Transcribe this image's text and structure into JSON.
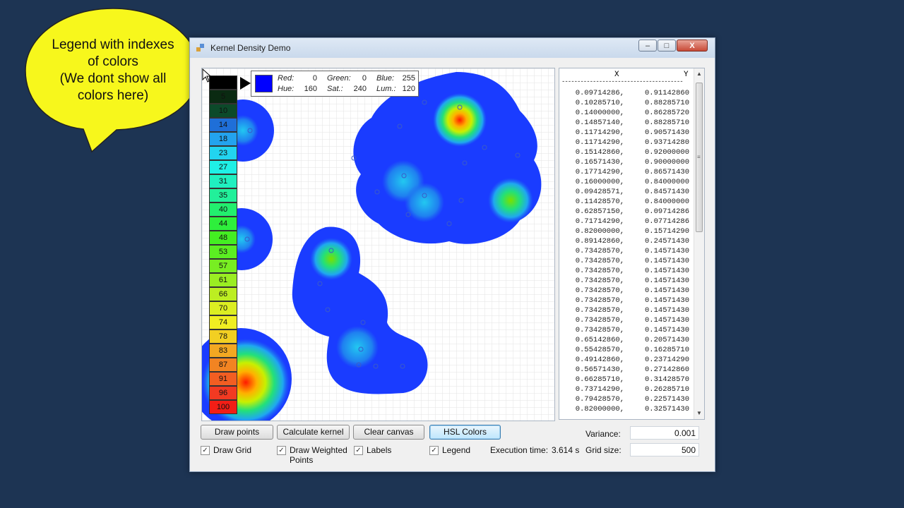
{
  "callout": {
    "lines": [
      "Legend with indexes",
      "of colors",
      "(We dont show all",
      "colors here)"
    ]
  },
  "window": {
    "title": "Kernel Density Demo",
    "controls": {
      "minimize": "–",
      "maximize": "□",
      "close": "X"
    }
  },
  "legend": {
    "values": [
      "",
      "5",
      "10",
      "14",
      "18",
      "23",
      "27",
      "31",
      "35",
      "40",
      "44",
      "48",
      "53",
      "57",
      "61",
      "66",
      "70",
      "74",
      "78",
      "83",
      "87",
      "91",
      "96",
      "100"
    ],
    "colors": [
      "#000000",
      "#0a2a12",
      "#0c4a2a",
      "#1f6fd8",
      "#23a3ee",
      "#22d4f0",
      "#1ff0e6",
      "#20f0c0",
      "#22f09a",
      "#22ef6e",
      "#2eef3c",
      "#44ee22",
      "#5bee22",
      "#78ee22",
      "#9aee22",
      "#bcee22",
      "#dcee22",
      "#f0ee22",
      "#f2cf22",
      "#f2a822",
      "#f28422",
      "#f25e22",
      "#f23a22",
      "#f21e16"
    ]
  },
  "color_info": {
    "red_label": "Red:",
    "red": "0",
    "green_label": "Green:",
    "green": "0",
    "blue_label": "Blue:",
    "blue": "255",
    "hue_label": "Hue:",
    "hue": "160",
    "sat_label": "Sat.:",
    "sat": "240",
    "lum_label": "Lum.:",
    "lum": "120",
    "swatch_color": "#0000ff"
  },
  "datalist": {
    "header_x": "X",
    "header_y": "Y",
    "separator": "---------------------------------------",
    "rows": [
      [
        "0.09714286,",
        "0.91142860"
      ],
      [
        "0.10285710,",
        "0.88285710"
      ],
      [
        "0.14000000,",
        "0.86285720"
      ],
      [
        "0.14857140,",
        "0.88285710"
      ],
      [
        "0.11714290,",
        "0.90571430"
      ],
      [
        "0.11714290,",
        "0.93714280"
      ],
      [
        "0.15142860,",
        "0.92000000"
      ],
      [
        "0.16571430,",
        "0.90000000"
      ],
      [
        "0.17714290,",
        "0.86571430"
      ],
      [
        "0.16000000,",
        "0.84000000"
      ],
      [
        "0.09428571,",
        "0.84571430"
      ],
      [
        "0.11428570,",
        "0.84000000"
      ],
      [
        "0.62857150,",
        "0.09714286"
      ],
      [
        "0.71714290,",
        "0.07714286"
      ],
      [
        "0.82000000,",
        "0.15714290"
      ],
      [
        "0.89142860,",
        "0.24571430"
      ],
      [
        "0.73428570,",
        "0.14571430"
      ],
      [
        "0.73428570,",
        "0.14571430"
      ],
      [
        "0.73428570,",
        "0.14571430"
      ],
      [
        "0.73428570,",
        "0.14571430"
      ],
      [
        "0.73428570,",
        "0.14571430"
      ],
      [
        "0.73428570,",
        "0.14571430"
      ],
      [
        "0.73428570,",
        "0.14571430"
      ],
      [
        "0.73428570,",
        "0.14571430"
      ],
      [
        "0.73428570,",
        "0.14571430"
      ],
      [
        "0.65142860,",
        "0.20571430"
      ],
      [
        "0.55428570,",
        "0.16285710"
      ],
      [
        "0.49142860,",
        "0.23714290"
      ],
      [
        "0.56571430,",
        "0.27142860"
      ],
      [
        "0.66285710,",
        "0.31428570"
      ],
      [
        "0.73714290,",
        "0.26285710"
      ],
      [
        "0.79428570,",
        "0.22571430"
      ],
      [
        "0.82000000,",
        "0.32571430"
      ]
    ]
  },
  "buttons": {
    "draw_points": "Draw points",
    "calculate_kernel": "Calculate kernel",
    "clear_canvas": "Clear canvas",
    "hsl_colors": "HSL Colors"
  },
  "checkboxes": {
    "draw_grid": "Draw Grid",
    "draw_weighted_line1": "Draw Weighted",
    "draw_weighted_line2": "Points",
    "labels": "Labels",
    "legend": "Legend",
    "checkmark": "✓"
  },
  "stats": {
    "execution_label": "Execution time:",
    "execution_value": "3.614 s",
    "variance_label": "Variance:",
    "variance_value": "0.001",
    "grid_label": "Grid size:",
    "grid_value": "500"
  },
  "colors": {
    "background": "#1d3453",
    "callout_fill": "#f7f71c",
    "density_low": "#0033ff",
    "density_high": "#ff1a00"
  }
}
